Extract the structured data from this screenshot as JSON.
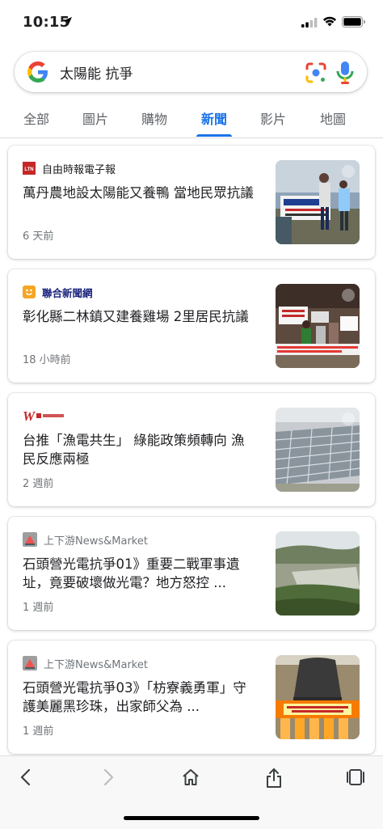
{
  "status_bar": {
    "time": "10:15"
  },
  "search": {
    "query": "太陽能 抗爭"
  },
  "tabs": [
    {
      "label": "全部",
      "active": false
    },
    {
      "label": "圖片",
      "active": false
    },
    {
      "label": "購物",
      "active": false
    },
    {
      "label": "新聞",
      "active": true
    },
    {
      "label": "影片",
      "active": false
    },
    {
      "label": "地圖",
      "active": false
    }
  ],
  "articles": [
    {
      "source": "自由時報電子報",
      "source_icon": "ltn-logo-icon",
      "headline": "萬丹農地設太陽能又養鴨 當地民眾抗議",
      "age": "6 天前"
    },
    {
      "source": "聯合新聞網",
      "source_icon": "udn-logo-icon",
      "headline": "彰化縣二林鎮又建養雞場 2里居民抗議",
      "age": "18 小時前"
    },
    {
      "source": "",
      "source_icon": "world-news-logo-icon",
      "headline": "台推「漁電共生」 綠能政策頻轉向 漁民反應兩極",
      "age": "2 週前"
    },
    {
      "source": "上下游News&Market",
      "source_icon": "newsmarket-logo-icon",
      "headline": "石頭營光電抗爭01》重要二戰軍事遺址，竟要破壞做光電？地方怒控 ...",
      "age": "1 週前"
    },
    {
      "source": "上下游News&Market",
      "source_icon": "newsmarket-logo-icon",
      "headline": "石頭營光電抗爭03》「枋寮義勇軍」守護美麗黑珍珠，出家師父為 ...",
      "age": "1 週前"
    }
  ],
  "colors": {
    "accent": "#1a73e8",
    "muted": "#70757a",
    "text": "#202124"
  }
}
